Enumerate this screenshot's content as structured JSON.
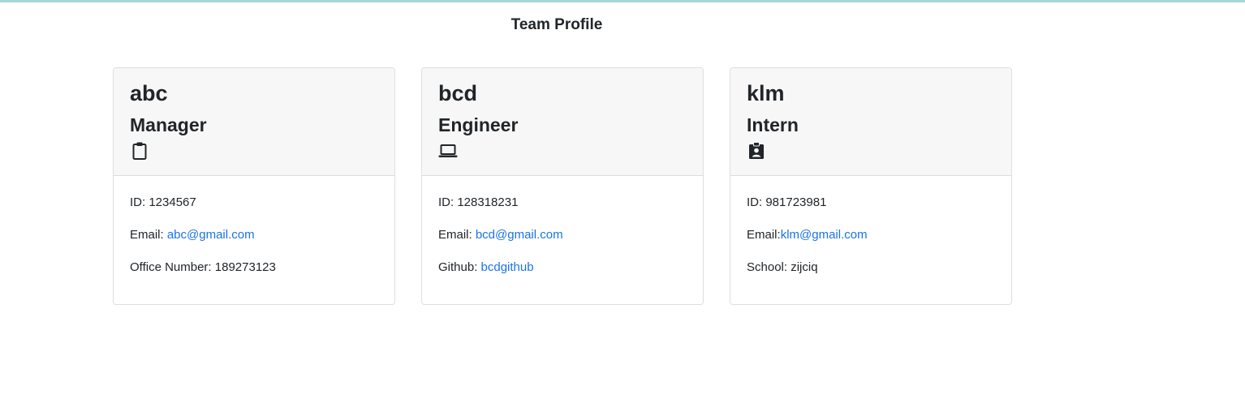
{
  "page": {
    "title": "Team Profile",
    "accent_color": "#a7d8d6",
    "link_color": "#1a73e8"
  },
  "cards": [
    {
      "name": "abc",
      "role": "Manager",
      "icon": "clipboard-icon",
      "id_label": "ID: ",
      "id_value": "1234567",
      "email_label": "Email: ",
      "email_value": "abc@gmail.com",
      "extra_label": "Office Number: ",
      "extra_value": "189273123"
    },
    {
      "name": "bcd",
      "role": "Engineer",
      "icon": "laptop-icon",
      "id_label": "ID: ",
      "id_value": "128318231",
      "email_label": "Email: ",
      "email_value": "bcd@gmail.com",
      "extra_label": "Github: ",
      "extra_value": "bcdgithub"
    },
    {
      "name": "klm",
      "role": "Intern",
      "icon": "id-badge-icon",
      "id_label": "ID: ",
      "id_value": "981723981",
      "email_label": "Email:",
      "email_value": "klm@gmail.com",
      "extra_label": "School: ",
      "extra_value": "zijciq"
    }
  ]
}
